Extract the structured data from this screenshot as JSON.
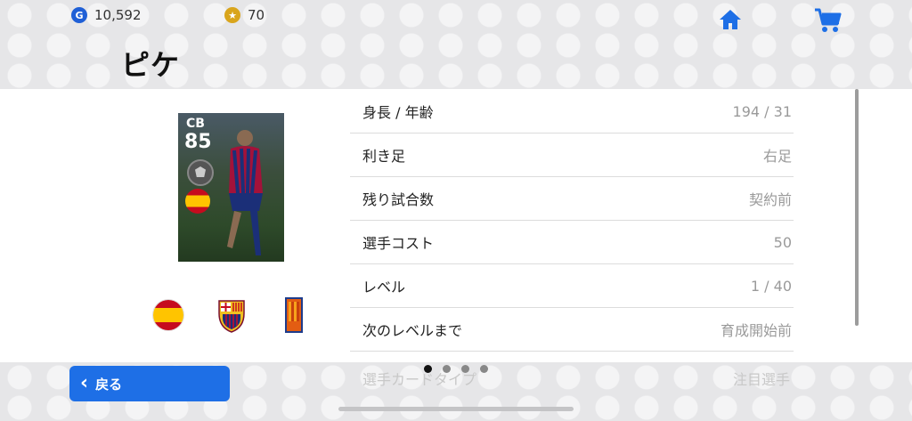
{
  "currency": {
    "gp_icon": "G",
    "gp_value": "10,592",
    "coins_icon": "★",
    "coins_value": "70"
  },
  "header": {
    "title": "ピケ",
    "home_icon": "home-icon",
    "cart_icon": "cart-icon"
  },
  "card": {
    "position": "CB",
    "overall": "85"
  },
  "info_rows": [
    {
      "label": "身長 / 年齢",
      "value": "194 / 31"
    },
    {
      "label": "利き足",
      "value": "右足"
    },
    {
      "label": "残り試合数",
      "value": "契約前"
    },
    {
      "label": "選手コスト",
      "value": "50"
    },
    {
      "label": "レベル",
      "value": "1 / 40"
    },
    {
      "label": "次のレベルまで",
      "value": "育成開始前"
    },
    {
      "label": "選手カードタイプ",
      "value": "注目選手"
    }
  ],
  "footer": {
    "back_label": "戻る",
    "back_icon": "chevron-left-icon"
  },
  "pagination": {
    "pages": 4,
    "active": 1
  },
  "colors": {
    "accent": "#1e6fe6",
    "gp": "#1f5fd6",
    "coin": "#d9a51c"
  }
}
